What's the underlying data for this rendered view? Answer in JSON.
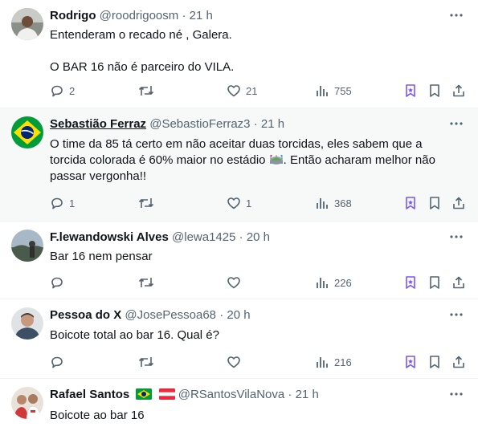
{
  "tweets": [
    {
      "name": "Rodrigo",
      "handle": "@roodrigoosm",
      "time": "21 h",
      "text": [
        "Entenderam o recado né , Galera.",
        "O BAR 16 não é parceiro do VILA."
      ],
      "replies": "2",
      "retweets": "",
      "likes": "21",
      "views": "755"
    },
    {
      "name": "Sebastião Ferraz",
      "handle": "@SebastioFerraz3",
      "time": "21 h",
      "text_before": "O time da 85 tá certo em não aceitar duas torcidas, eles sabem que a torcida colorada é 60% maior no estádio ",
      "text_after": ". Então acharam melhor não passar vergonha!!",
      "replies": "1",
      "retweets": "",
      "likes": "1",
      "views": "368"
    },
    {
      "name": "F.lewandowski Alves",
      "handle": "@lewa1425",
      "time": "20 h",
      "text": [
        "Bar 16 nem pensar"
      ],
      "replies": "",
      "retweets": "",
      "likes": "",
      "views": "226"
    },
    {
      "name": "Pessoa do X",
      "handle": "@JosePessoa68",
      "time": "20 h",
      "text": [
        "Boicote total ao bar 16. Qual é?"
      ],
      "replies": "",
      "retweets": "",
      "likes": "",
      "views": "216"
    },
    {
      "name": "Rafael Santos",
      "handle": "@RSantosVilaNova",
      "time": "21 h",
      "text": [
        "Boicote ao bar 16"
      ]
    }
  ],
  "separator": "·",
  "icons": {
    "reply": "reply-icon",
    "retweet": "retweet-icon",
    "like": "like-icon",
    "views": "views-icon",
    "grok": "grok-icon",
    "bookmark": "bookmark-icon",
    "share": "share-icon",
    "more": "more-icon"
  },
  "colors": {
    "text_primary": "#0f1419",
    "text_secondary": "#536471",
    "accent": "#7856ff",
    "highlight_bg": "#f7f9f9",
    "divider": "#eff3f4"
  }
}
